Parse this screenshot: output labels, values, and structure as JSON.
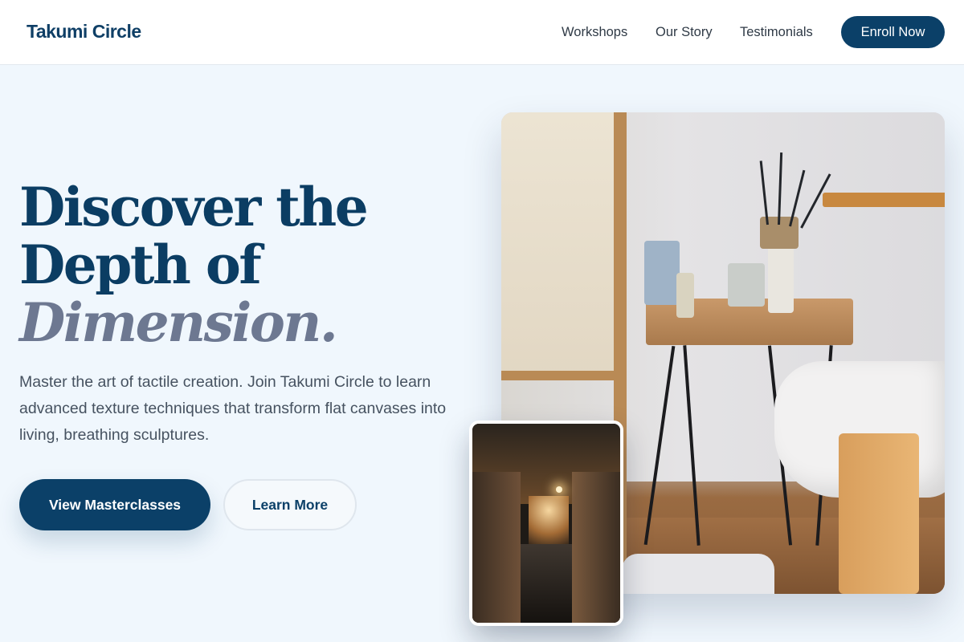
{
  "nav": {
    "brand": "Takumi Circle",
    "links": [
      "Workshops",
      "Our Story",
      "Testimonials"
    ],
    "cta": "Enroll Now"
  },
  "hero": {
    "headline_line1": "Discover the",
    "headline_line2": "Depth of",
    "headline_accent": "Dimension.",
    "lede": "Master the art of tactile creation. Join Takumi Circle to learn advanced texture techniques that transform flat canvases into living, breathing sculptures.",
    "primary_button": "View Masterclasses",
    "secondary_button": "Learn More"
  },
  "colors": {
    "brand_navy": "#0b4068",
    "accent_slate": "#6d7891",
    "page_background": "#f0f7fd"
  },
  "images": {
    "main": "art-studio-table-photo",
    "inset": "gallery-corridor-photo"
  }
}
